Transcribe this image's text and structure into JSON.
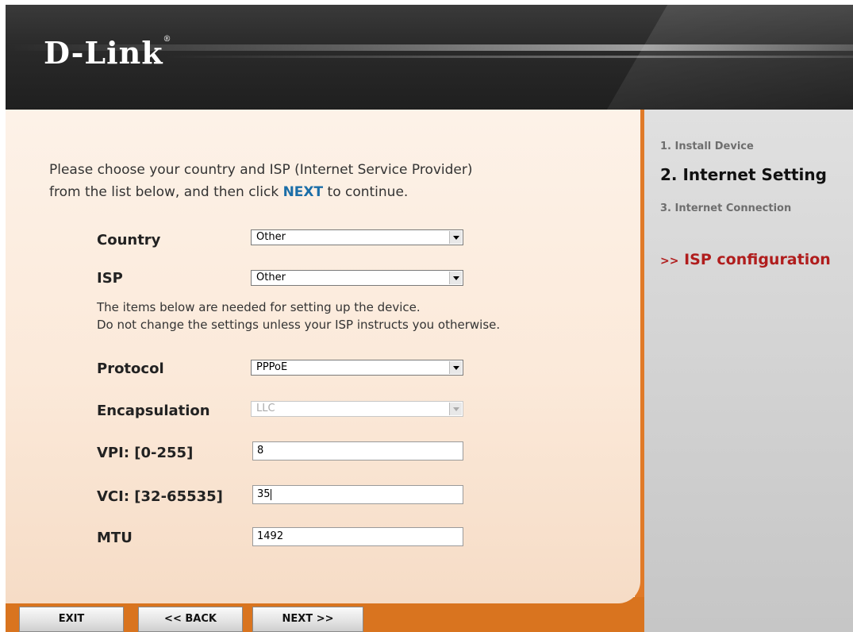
{
  "brand": {
    "logo_text": "D-Link",
    "trademark": "®"
  },
  "intro": {
    "line1": "Please choose your country and ISP (Internet Service Provider)",
    "line2_before": "from the list below, and then click ",
    "line2_next": "NEXT",
    "line2_after": " to continue."
  },
  "form": {
    "country": {
      "label": "Country",
      "value": "Other"
    },
    "isp": {
      "label": "ISP",
      "value": "Other"
    },
    "note_line1": "The items below are needed for setting up the device.",
    "note_line2": "Do not change the settings unless your ISP instructs you otherwise.",
    "protocol": {
      "label": "Protocol",
      "value": "PPPoE"
    },
    "encapsulation": {
      "label": "Encapsulation",
      "value": "LLC"
    },
    "vpi": {
      "label": "VPI: [0-255]",
      "value": "8"
    },
    "vci": {
      "label": "VCI: [32-65535]",
      "value": "35"
    },
    "mtu": {
      "label": "MTU",
      "value": "1492"
    }
  },
  "steps": {
    "step1": "1. Install Device",
    "step2": "2.  Internet Setting",
    "step3": "3.  Internet Connection",
    "current_prefix": ">>",
    "current_sub": "ISP  configuration"
  },
  "buttons": {
    "exit": "EXIT",
    "back": "<< BACK",
    "next": "NEXT >>"
  },
  "colors": {
    "accent_orange": "#d9741f",
    "highlight_red": "#b01d1d",
    "next_blue": "#1b6ea8"
  }
}
